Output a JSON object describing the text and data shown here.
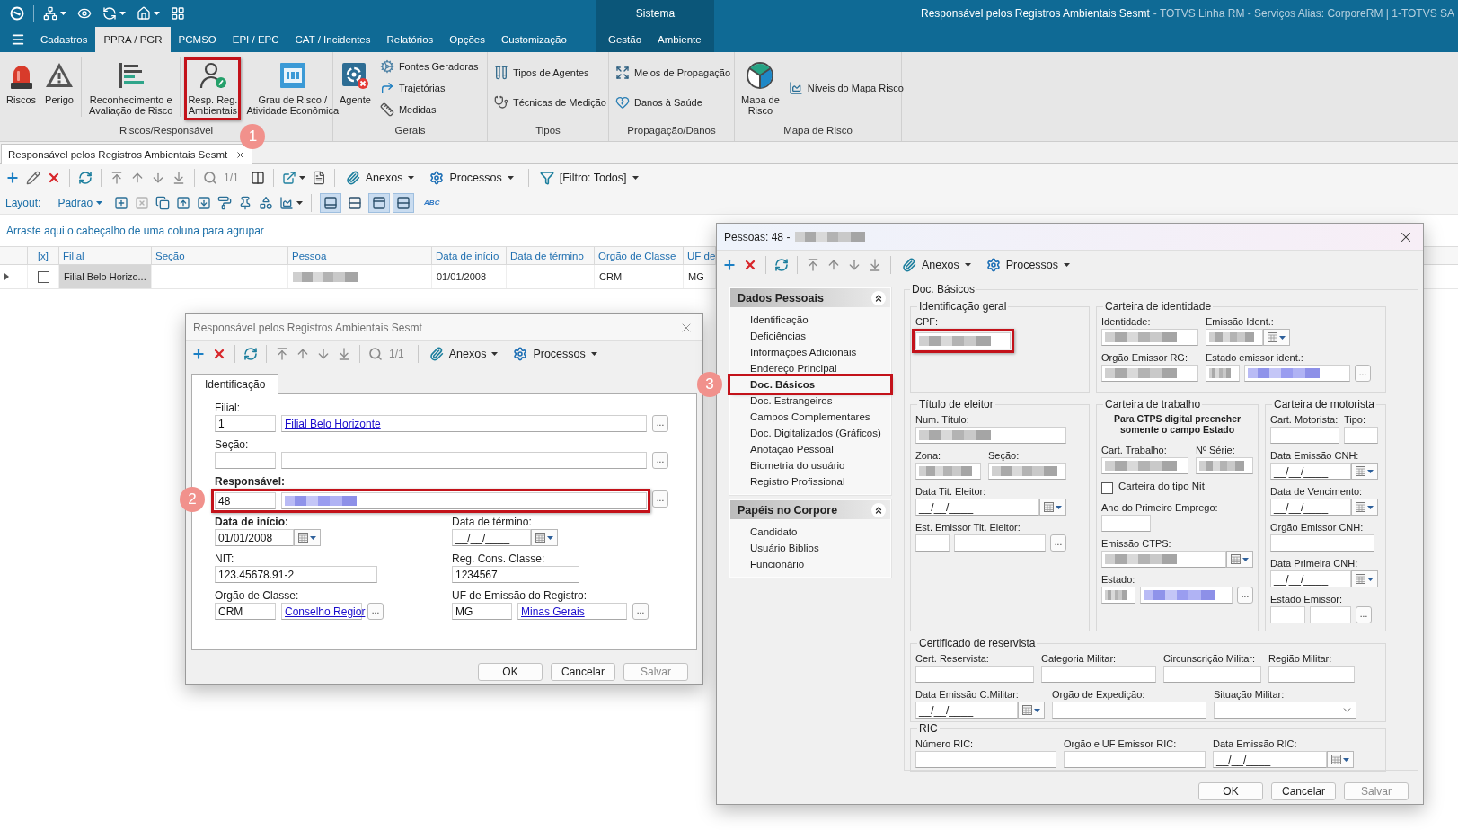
{
  "title_bar": {
    "context_group": "Sistema",
    "title": "Responsável pelos Registros Ambientais Sesmt",
    "app_info": "- TOTVS Linha RM - Serviços Alias: CorporeRM | 1-TOTVS SA"
  },
  "ribbon": {
    "tabs": [
      {
        "label": "Cadastros",
        "selected": false
      },
      {
        "label": "PPRA / PGR",
        "selected": true
      },
      {
        "label": "PCMSO",
        "selected": false
      },
      {
        "label": "EPI / EPC",
        "selected": false
      },
      {
        "label": "CAT / Incidentes",
        "selected": false
      },
      {
        "label": "Relatórios",
        "selected": false
      },
      {
        "label": "Opções",
        "selected": false
      },
      {
        "label": "Customização",
        "selected": false
      }
    ],
    "context_tabs": [
      {
        "label": "Gestão",
        "selected": false
      },
      {
        "label": "Ambiente",
        "selected": false
      }
    ],
    "groups": [
      {
        "label": "Riscos/Responsável",
        "items": [
          {
            "kind": "large",
            "label": "Riscos"
          },
          {
            "kind": "large",
            "label": "Perigo"
          },
          {
            "kind": "large",
            "label": "Reconhecimento e\nAvaliação de Risco"
          },
          {
            "kind": "large",
            "label": "Resp. Reg.\nAmbientais",
            "highlighted": true,
            "callout": "1"
          },
          {
            "kind": "large",
            "label": "Grau de Risco /\nAtividade Econômica"
          }
        ]
      },
      {
        "label": "Gerais",
        "items": [
          {
            "kind": "large",
            "label": "Agente"
          },
          {
            "kind": "small",
            "label": "Fontes Geradoras"
          },
          {
            "kind": "small",
            "label": "Trajetórias"
          },
          {
            "kind": "small",
            "label": "Medidas"
          }
        ]
      },
      {
        "label": "Tipos",
        "items": [
          {
            "kind": "small",
            "label": "Tipos de Agentes"
          },
          {
            "kind": "small",
            "label": "Técnicas de Medição"
          }
        ]
      },
      {
        "label": "Propagação/Danos",
        "items": [
          {
            "kind": "small",
            "label": "Meios de Propagação"
          },
          {
            "kind": "small",
            "label": "Danos à Saúde"
          }
        ]
      },
      {
        "label": "Mapa de Risco",
        "items": [
          {
            "kind": "large",
            "label": "Mapa de\nRisco"
          },
          {
            "kind": "small",
            "label": "Níveis do Mapa Risco"
          }
        ]
      }
    ]
  },
  "document_tabs": [
    {
      "label": "Responsável pelos Registros Ambientais Sesmt",
      "selected": true
    }
  ],
  "toolbar": {
    "page": "1/1",
    "menus": [
      {
        "label": "Anexos"
      },
      {
        "label": "Processos"
      },
      {
        "label": "[Filtro: Todos]"
      }
    ]
  },
  "layout_bar": {
    "label": "Layout:",
    "preset": "Padrão",
    "tools": [
      {
        "disabled": false
      },
      {
        "disabled": true
      },
      {
        "disabled": false
      },
      {
        "disabled": false
      },
      {
        "disabled": false
      },
      {
        "disabled": false
      },
      {
        "disabled": false
      },
      {
        "disabled": false
      },
      {
        "disabled": false
      }
    ],
    "views": [
      {
        "selected": true
      },
      {
        "selected": false
      },
      {
        "selected": true
      },
      {
        "selected": true
      }
    ],
    "spell_check": "ABC"
  },
  "group_hint": "Arraste aqui o cabeçalho de uma coluna para agrupar",
  "grid": {
    "columns": [
      "[x]",
      "Filial",
      "Seção",
      "Pessoa",
      "Data de início",
      "Data de término",
      "Orgão de Classe",
      "UF de"
    ],
    "rows": [
      {
        "cells": [
          {
            "kind": "checkbox",
            "checked": false
          },
          {
            "kind": "text",
            "text": "Filial Belo Horizo...",
            "focused": true
          },
          {
            "kind": "empty"
          },
          {
            "kind": "redacted"
          },
          {
            "kind": "text",
            "text": "01/01/2008",
            "focused": false
          },
          {
            "kind": "empty"
          },
          {
            "kind": "text",
            "text": "CRM",
            "focused": false
          },
          {
            "kind": "text",
            "text": "MG",
            "focused": false
          }
        ]
      }
    ]
  },
  "edit_dialog": {
    "title": "Responsável pelos Registros Ambientais Sesmt",
    "page": "1/1",
    "menus": [
      {
        "label": "Anexos"
      },
      {
        "label": "Processos"
      }
    ],
    "tabs": [
      {
        "label": "Identificação",
        "selected": true
      }
    ],
    "fields": [
      {
        "label": "Filial:",
        "bold": false,
        "controls": [
          {
            "kind": "input",
            "value": "1"
          },
          {
            "kind": "link_input",
            "value": "Filial Belo Horizonte"
          },
          {
            "kind": "browse",
            "label": "..."
          }
        ]
      },
      {
        "label": "Seção:",
        "bold": false,
        "controls": [
          {
            "kind": "input"
          },
          {
            "kind": "input"
          },
          {
            "kind": "browse",
            "label": "..."
          }
        ]
      },
      {
        "label": "Responsável:",
        "bold": true,
        "highlighted": true,
        "callout": "2",
        "controls": [
          {
            "kind": "input",
            "value": "48"
          },
          {
            "kind": "link_input",
            "redacted": true
          },
          {
            "kind": "browse",
            "label": "..."
          }
        ]
      },
      {
        "label": "Data de início:",
        "bold": true,
        "controls": [
          {
            "kind": "date",
            "value": "01/01/2008"
          }
        ]
      },
      {
        "label": "Data de término:",
        "bold": false,
        "controls": [
          {
            "kind": "date",
            "value": "__/__/____"
          }
        ]
      },
      {
        "label": "NIT:",
        "bold": false,
        "controls": [
          {
            "kind": "input",
            "value": "123.45678.91-2"
          }
        ]
      },
      {
        "label": "Reg. Cons. Classe:",
        "bold": false,
        "controls": [
          {
            "kind": "input",
            "value": "1234567"
          }
        ]
      },
      {
        "label": "Orgão de Classe:",
        "bold": false,
        "controls": [
          {
            "kind": "input",
            "value": "CRM"
          },
          {
            "kind": "link_input",
            "value": "Conselho Regior"
          },
          {
            "kind": "browse",
            "label": "..."
          }
        ]
      },
      {
        "label": "UF de Emissão do Registro:",
        "bold": false,
        "controls": [
          {
            "kind": "input",
            "value": "MG"
          },
          {
            "kind": "link_input",
            "value": "Minas Gerais"
          },
          {
            "kind": "browse",
            "label": "..."
          }
        ]
      }
    ],
    "buttons": [
      {
        "label": "OK",
        "disabled": false
      },
      {
        "label": "Cancelar",
        "disabled": false
      },
      {
        "label": "Salvar",
        "disabled": true
      }
    ]
  },
  "person_dialog": {
    "title": "Pessoas: 48 -",
    "title_redacted": true,
    "menus": [
      {
        "label": "Anexos"
      },
      {
        "label": "Processos"
      }
    ],
    "sidebar": [
      {
        "label": "Dados Pessoais",
        "expanded": true,
        "items": [
          {
            "label": "Identificação",
            "selected": false
          },
          {
            "label": "Deficiências",
            "selected": false
          },
          {
            "label": "Informações Adicionais",
            "selected": false
          },
          {
            "label": "Endereço Principal",
            "selected": false
          },
          {
            "label": "Doc. Básicos",
            "selected": true,
            "highlighted": true,
            "callout": "3"
          },
          {
            "label": "Doc. Estrangeiros",
            "selected": false
          },
          {
            "label": "Campos Complementares",
            "selected": false
          },
          {
            "label": "Doc. Digitalizados (Gráficos)",
            "selected": false
          },
          {
            "label": "Anotação Pessoal",
            "selected": false
          },
          {
            "label": "Biometria do usuário",
            "selected": false
          },
          {
            "label": "Registro Profissional",
            "selected": false
          }
        ]
      },
      {
        "label": "Papéis no Corpore",
        "expanded": true,
        "items": [
          {
            "label": "Candidato",
            "selected": false
          },
          {
            "label": "Usuário Biblios",
            "selected": false
          },
          {
            "label": "Funcionário",
            "selected": false
          }
        ]
      }
    ],
    "content": {
      "title": "Doc. Básicos",
      "groups": [
        {
          "title": "Identificação geral",
          "fields": [
            {
              "label": "CPF:",
              "highlighted": true,
              "controls": [
                {
                  "kind": "input",
                  "redacted": true
                }
              ]
            }
          ]
        },
        {
          "title": "Carteira de identidade",
          "fields": [
            {
              "label": "Identidade:",
              "controls": [
                {
                  "kind": "input",
                  "redacted": true
                }
              ]
            },
            {
              "label": "Emissão Ident.:",
              "controls": [
                {
                  "kind": "date",
                  "redacted": true
                }
              ]
            },
            {
              "label": "Orgão Emissor RG:",
              "controls": [
                {
                  "kind": "input",
                  "redacted": true
                }
              ]
            },
            {
              "label": "Estado emissor ident.:",
              "controls": [
                {
                  "kind": "input",
                  "redacted": true
                },
                {
                  "kind": "link_input",
                  "redacted": true
                },
                {
                  "kind": "browse",
                  "label": "..."
                }
              ]
            }
          ]
        },
        {
          "title": "Título de eleitor",
          "fields": [
            {
              "label": "Num. Título:",
              "controls": [
                {
                  "kind": "input",
                  "redacted": true
                }
              ]
            },
            {
              "label": "Zona:",
              "controls": [
                {
                  "kind": "input",
                  "redacted": true
                }
              ]
            },
            {
              "label": "Seção:",
              "controls": [
                {
                  "kind": "input",
                  "redacted": true
                }
              ]
            },
            {
              "label": "Data Tit. Eleitor:",
              "controls": [
                {
                  "kind": "date",
                  "value": "__/__/____"
                }
              ]
            },
            {
              "label": "Est. Emissor Tit. Eleitor:",
              "controls": [
                {
                  "kind": "input"
                },
                {
                  "kind": "input"
                },
                {
                  "kind": "browse",
                  "label": "..."
                }
              ]
            }
          ]
        },
        {
          "title": "Carteira de trabalho",
          "note": "Para CTPS digital preencher\nsomente o campo Estado",
          "fields": [
            {
              "kind": "field",
              "label": "Cart. Trabalho:",
              "controls": [
                {
                  "kind": "input",
                  "redacted": true
                }
              ]
            },
            {
              "kind": "field",
              "label": "Nº Série:",
              "controls": [
                {
                  "kind": "input",
                  "redacted": true
                }
              ]
            },
            {
              "kind": "checkbox",
              "label": "Carteira do tipo Nit",
              "checked": false
            },
            {
              "kind": "field",
              "label": "Ano do Primeiro Emprego:",
              "controls": [
                {
                  "kind": "input"
                }
              ]
            },
            {
              "kind": "field",
              "label": "Emissão CTPS:",
              "controls": [
                {
                  "kind": "date",
                  "redacted": true
                }
              ]
            },
            {
              "kind": "field",
              "label": "Estado:",
              "controls": [
                {
                  "kind": "input",
                  "redacted": true
                },
                {
                  "kind": "link_input",
                  "redacted": true
                },
                {
                  "kind": "browse",
                  "label": "..."
                }
              ]
            }
          ]
        },
        {
          "title": "Carteira de motorista",
          "fields": [
            {
              "label": "Cart. Motorista:",
              "controls": [
                {
                  "kind": "input"
                }
              ]
            },
            {
              "label": "Tipo:",
              "controls": [
                {
                  "kind": "input"
                }
              ]
            },
            {
              "label": "Data Emissão CNH:",
              "controls": [
                {
                  "kind": "date",
                  "value": "__/__/____"
                }
              ]
            },
            {
              "label": "Data de Vencimento:",
              "controls": [
                {
                  "kind": "date",
                  "value": "__/__/____"
                }
              ]
            },
            {
              "label": "Orgão Emissor CNH:",
              "controls": [
                {
                  "kind": "input"
                }
              ]
            },
            {
              "label": "Data Primeira CNH:",
              "controls": [
                {
                  "kind": "date",
                  "value": "__/__/____"
                }
              ]
            },
            {
              "label": "Estado Emissor:",
              "controls": [
                {
                  "kind": "input"
                },
                {
                  "kind": "input"
                },
                {
                  "kind": "browse",
                  "label": "..."
                }
              ]
            }
          ]
        },
        {
          "title": "Certificado de reservista",
          "fields": [
            {
              "label": "Cert. Reservista:",
              "controls": [
                {
                  "kind": "input"
                }
              ]
            },
            {
              "label": "Categoria Militar:",
              "controls": [
                {
                  "kind": "input"
                }
              ]
            },
            {
              "label": "Circunscrição Militar:",
              "controls": [
                {
                  "kind": "input"
                }
              ]
            },
            {
              "label": "Região Militar:",
              "controls": [
                {
                  "kind": "input"
                }
              ]
            },
            {
              "label": "Data Emissão C.Militar:",
              "controls": [
                {
                  "kind": "date",
                  "value": "__/__/____"
                }
              ]
            },
            {
              "label": "Orgão de Expedição:",
              "controls": [
                {
                  "kind": "input"
                }
              ]
            },
            {
              "label": "Situação Militar:",
              "controls": [
                {
                  "kind": "select"
                }
              ]
            }
          ]
        },
        {
          "title": "RIC",
          "fields": [
            {
              "label": "Número RIC:",
              "controls": [
                {
                  "kind": "input"
                }
              ]
            },
            {
              "label": "Orgão e UF Emissor RIC:",
              "controls": [
                {
                  "kind": "input"
                }
              ]
            },
            {
              "label": "Data Emissão RIC:",
              "controls": [
                {
                  "kind": "date",
                  "value": "__/__/____"
                }
              ]
            }
          ]
        }
      ]
    },
    "buttons": [
      {
        "label": "OK",
        "disabled": false
      },
      {
        "label": "Cancelar",
        "disabled": false
      },
      {
        "label": "Salvar",
        "disabled": true
      }
    ]
  }
}
